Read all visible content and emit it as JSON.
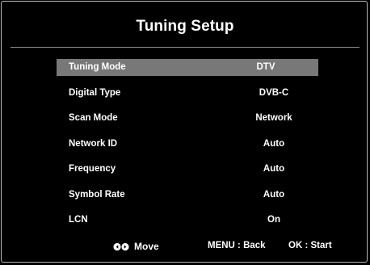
{
  "screen": {
    "title": "Tuning Setup"
  },
  "menu": {
    "items": [
      {
        "label": "Tuning Mode",
        "value": "DTV"
      },
      {
        "label": "Digital Type",
        "value": "DVB-C"
      },
      {
        "label": "Scan Mode",
        "value": "Network"
      },
      {
        "label": "Network ID",
        "value": "Auto"
      },
      {
        "label": "Frequency",
        "value": "Auto"
      },
      {
        "label": "Symbol Rate",
        "value": "Auto"
      },
      {
        "label": "LCN",
        "value": "On"
      }
    ],
    "selected_index": 0
  },
  "footer": {
    "nav_icon": "left-right-arrows-icon",
    "move_label": "Move",
    "back_label": "MENU : Back",
    "start_label": "OK : Start"
  },
  "colors": {
    "background": "#000000",
    "selected_row": "#787878",
    "divider": "#8e8e8e",
    "frame_border": "#b9b9b9"
  }
}
